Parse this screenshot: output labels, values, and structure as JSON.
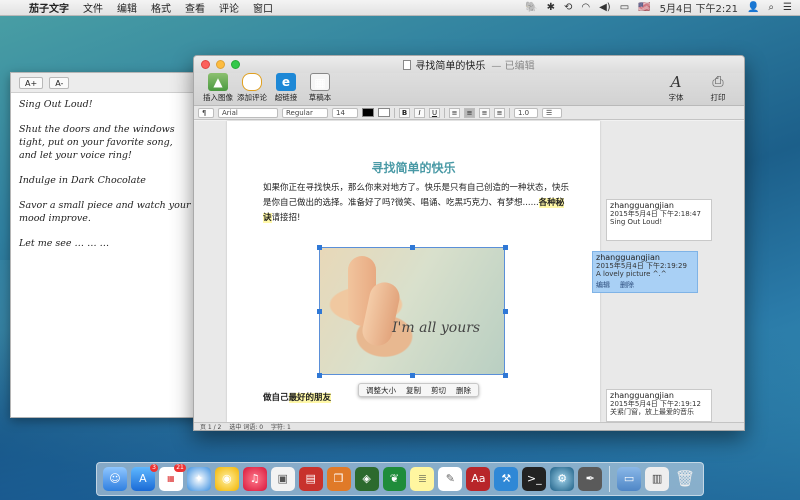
{
  "menubar": {
    "app_name": "茄子文字",
    "menus": [
      "文件",
      "编辑",
      "格式",
      "查看",
      "评论",
      "窗口"
    ],
    "status_flag": "🇺🇸",
    "datetime": "5月4日 下午2:21"
  },
  "note_window": {
    "font_larger": "A+",
    "font_smaller": "A-",
    "lines": [
      "Sing Out Loud!",
      "Shut the doors and the windows tight, put on your favorite song, and let your voice ring!",
      "Indulge in Dark Chocolate",
      "Savor a small piece and watch your mood improve.",
      "Let me see … … …"
    ]
  },
  "window": {
    "title": "寻找简单的快乐",
    "edited": "— 已编辑",
    "toolbar": {
      "insert_image": "插入图像",
      "add_comment": "添加评论",
      "hyperlink": "超链接",
      "sketch": "草稿本",
      "font": "字体",
      "print": "打印"
    },
    "format": {
      "paragraph_icon": "¶",
      "font_family": "Arial",
      "font_style": "Regular",
      "font_size": "14",
      "line_spacing": "1.0"
    },
    "document": {
      "title": "寻找简单的快乐",
      "paragraph": "如果你正在寻找快乐，那么你来对地方了。快乐是只有自己创造的一种状态，快乐是你自己做出的选择。准备好了吗?微笑、唱诵、吃黑巧克力、有梦想......",
      "highlight_1": "各种秘诀",
      "paragraph_tail": "请接招!",
      "image_text": "I'm all yours",
      "subheading_prefix": "做自己",
      "subheading_highlight": "最好的朋友"
    },
    "context_menu": [
      "调整大小",
      "复制",
      "剪切",
      "删除"
    ],
    "status": {
      "page": "页 1 / 2",
      "selected": "选中 词语: 0",
      "chars": "字符: 1"
    },
    "comments": [
      {
        "user": "zhangguangjian",
        "time": "2015年5月4日 下午2:18:47",
        "text": "Sing Out Loud!"
      },
      {
        "user": "zhangguangjian",
        "time": "2015年5月4日 下午2:19:29",
        "text": "A lovely picture ^.^",
        "edit": "编辑",
        "delete": "删除"
      },
      {
        "user": "zhangguangjian",
        "time": "2015年5月4日 下午2:19:12",
        "text": "关紧门窗，放上最爱的音乐"
      }
    ]
  },
  "dock": {
    "badge_appstore": "3",
    "badge_calendar": "21"
  }
}
